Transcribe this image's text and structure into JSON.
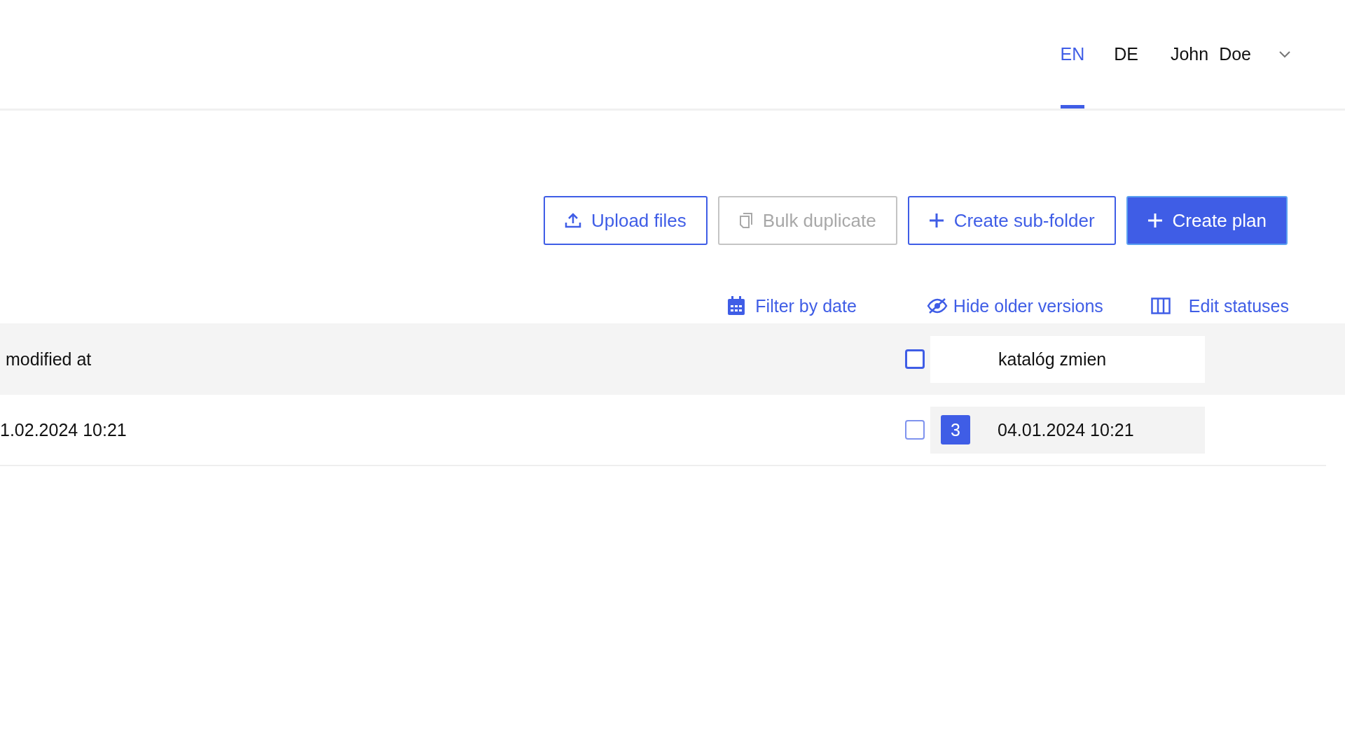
{
  "header": {
    "languages": [
      {
        "label": "EN",
        "selected": true
      },
      {
        "label": "DE",
        "selected": false
      }
    ],
    "user": "John Doe"
  },
  "toolbar": {
    "buttons": [
      {
        "label": "Upload files",
        "kind": "upload",
        "primary": false,
        "disabled": false
      },
      {
        "label": "Bulk duplicate",
        "kind": "duplicate",
        "primary": false,
        "disabled": true
      },
      {
        "label": "Create sub-folder",
        "kind": "plus",
        "primary": false,
        "disabled": false
      },
      {
        "label": "Create plan",
        "kind": "plus",
        "primary": true,
        "disabled": false
      }
    ]
  },
  "filters": [
    {
      "label": "Filter by date",
      "kind": "calendar"
    },
    {
      "label": "Hide older versions",
      "kind": "eye"
    },
    {
      "label": "Edit statuses",
      "kind": "columns"
    }
  ],
  "table": {
    "header": {
      "column_1": "modified at",
      "checked": false,
      "column_3": "katalóg zmien"
    },
    "rows": [
      {
        "column_1": "1.02.2024 10:21",
        "checked": false,
        "version": "3",
        "column_3": "04.01.2024 10:21"
      }
    ]
  }
}
